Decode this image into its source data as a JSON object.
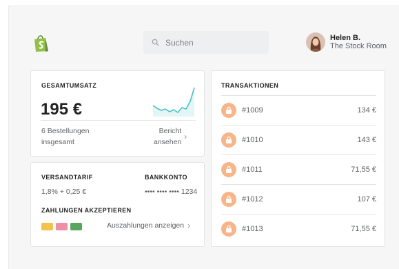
{
  "header": {
    "search_placeholder": "Suchen",
    "user_name": "Helen B.",
    "store_name": "The Stock Room"
  },
  "sales": {
    "title": "GESAMTUMSATZ",
    "total": "195 €",
    "orders_line1": "6 Bestellungen",
    "orders_line2": "insgesamt",
    "report_line1": "Bericht",
    "report_line2": "ansehen"
  },
  "rates": {
    "shipping_title": "VERSANDTARIF",
    "shipping_value": "1,8% + 0,25 €",
    "bank_title": "BANKKONTO",
    "bank_value": "•••• •••• •••• 1234",
    "payments_title": "ZAHLUNGEN AKZEPTIEREN",
    "payouts_link": "Auszahlungen anzeigen"
  },
  "transactions": {
    "title": "TRANSAKTIONEN",
    "items": [
      {
        "id": "#1009",
        "amount": "134 €"
      },
      {
        "id": "#1010",
        "amount": "143 €"
      },
      {
        "id": "#1011",
        "amount": "71,55 €"
      },
      {
        "id": "#1012",
        "amount": "107 €"
      },
      {
        "id": "#1013",
        "amount": "71,55 €"
      }
    ]
  },
  "colors": {
    "brand_green": "#95bf47",
    "sparkline": "#47c1bf",
    "lock_badge": "#f8b58a",
    "payment_card_1": "#f4c150",
    "payment_card_2": "#ef8fa6",
    "payment_card_3": "#58a65c"
  },
  "icons": {
    "logo": "shopify-bag-icon",
    "search": "search-icon",
    "lock": "lock-icon",
    "chevron": "chevron-right-icon"
  }
}
